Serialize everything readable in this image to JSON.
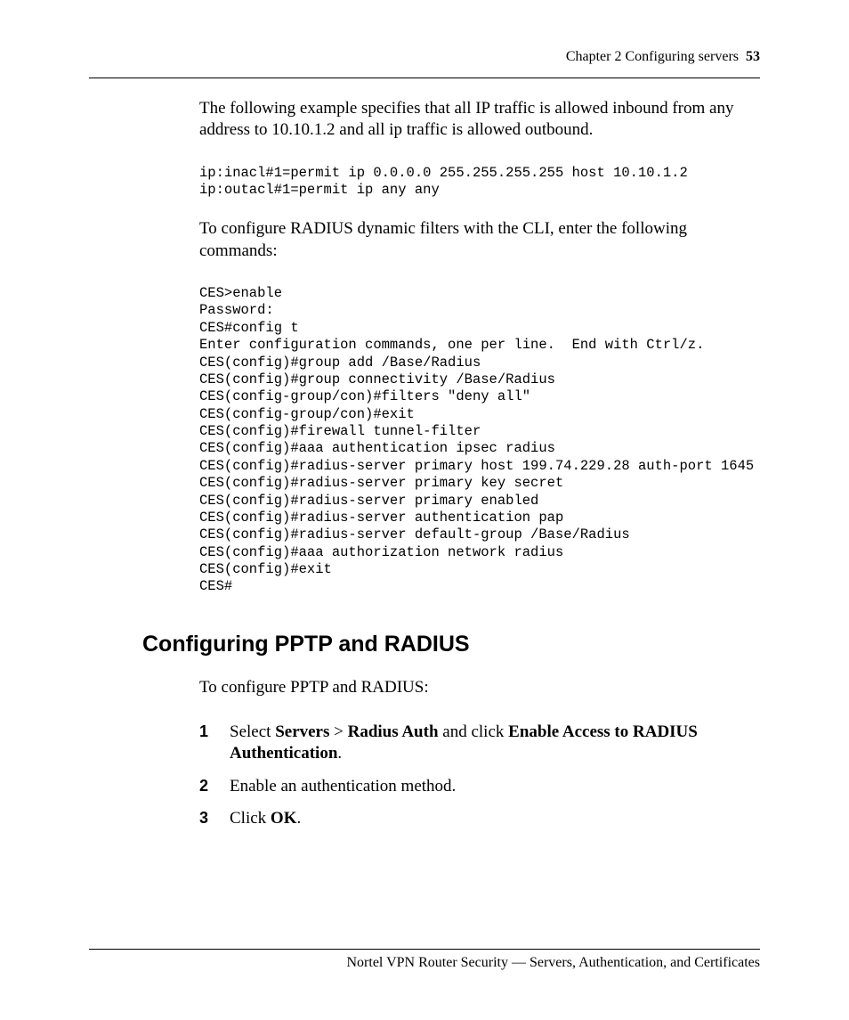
{
  "header": {
    "chapter": "Chapter 2  Configuring servers",
    "page": "53"
  },
  "p1": "The following example specifies that all IP traffic is allowed inbound from any address to 10.10.1.2 and all ip traffic is allowed outbound.",
  "code1": "ip:inacl#1=permit ip 0.0.0.0 255.255.255.255 host 10.10.1.2\nip:outacl#1=permit ip any any",
  "p2": "To configure RADIUS dynamic filters with the CLI, enter the following commands:",
  "code2": "CES>enable\nPassword:\nCES#config t\nEnter configuration commands, one per line.  End with Ctrl/z.\nCES(config)#group add /Base/Radius\nCES(config)#group connectivity /Base/Radius\nCES(config-group/con)#filters \"deny all\"\nCES(config-group/con)#exit\nCES(config)#firewall tunnel-filter\nCES(config)#aaa authentication ipsec radius\nCES(config)#radius-server primary host 199.74.229.28 auth-port 1645\nCES(config)#radius-server primary key secret\nCES(config)#radius-server primary enabled\nCES(config)#radius-server authentication pap\nCES(config)#radius-server default-group /Base/Radius\nCES(config)#aaa authorization network radius\nCES(config)#exit\nCES#",
  "h2": "Configuring PPTP and RADIUS",
  "p3": "To configure PPTP and RADIUS:",
  "steps": {
    "n1": "1",
    "s1a": "Select ",
    "s1b": "Servers",
    "s1c": " > ",
    "s1d": "Radius Auth",
    "s1e": " and click ",
    "s1f": "Enable Access to RADIUS Authentication",
    "s1g": ".",
    "n2": "2",
    "s2": "Enable an authentication method.",
    "n3": "3",
    "s3a": "Click ",
    "s3b": "OK",
    "s3c": "."
  },
  "footer": "Nortel VPN Router Security — Servers, Authentication, and Certificates"
}
